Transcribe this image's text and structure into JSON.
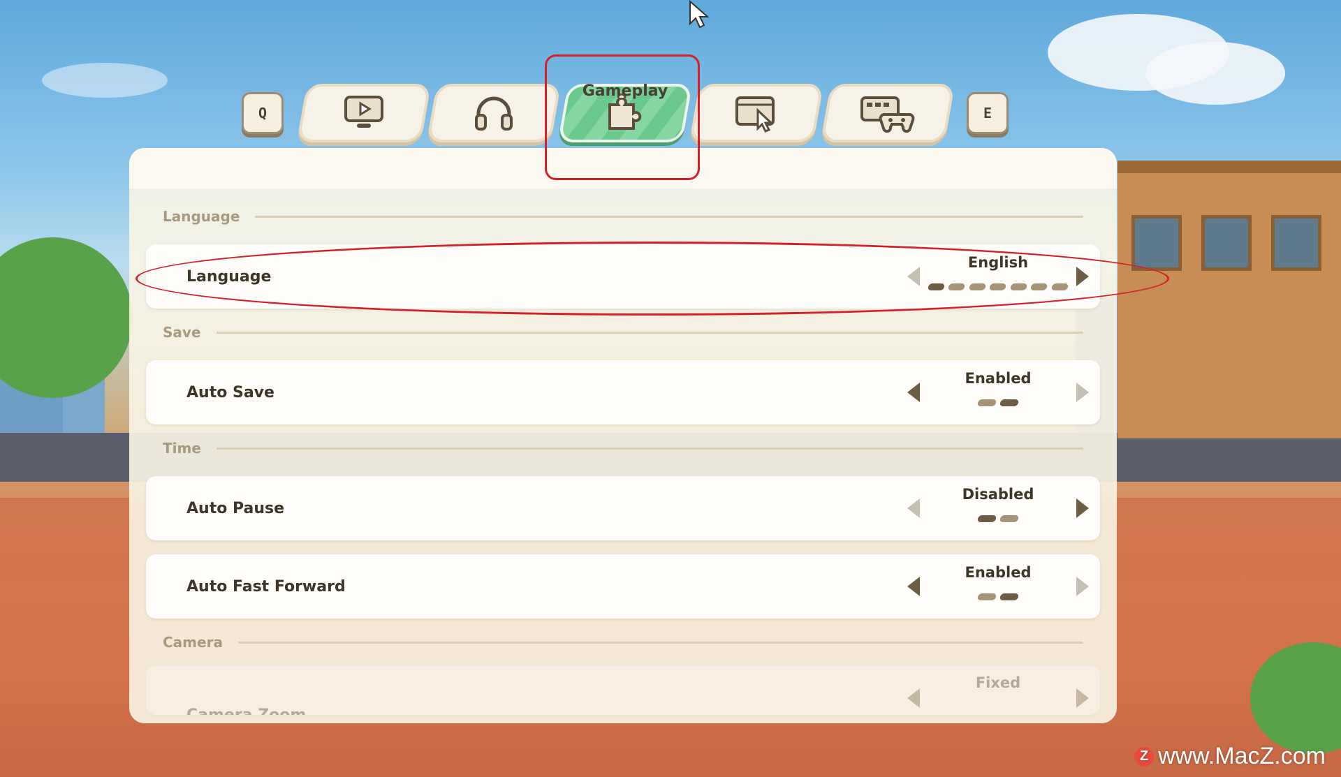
{
  "tabs": {
    "prev_key": "Q",
    "next_key": "E",
    "items": [
      {
        "icon": "monitor-play-icon",
        "label": "Display"
      },
      {
        "icon": "headphones-icon",
        "label": "Audio"
      },
      {
        "icon": "puzzle-icon",
        "label": "Gameplay",
        "active": true
      },
      {
        "icon": "window-cursor-icon",
        "label": "Interface"
      },
      {
        "icon": "keyboard-gamepad-icon",
        "label": "Controls"
      }
    ],
    "active_label": "Gameplay"
  },
  "sections": [
    {
      "title": "Language",
      "rows": [
        {
          "label": "Language",
          "value": "English",
          "options_count": 7,
          "selected_index": 0,
          "left_enabled": false,
          "right_enabled": true
        }
      ]
    },
    {
      "title": "Save",
      "rows": [
        {
          "label": "Auto Save",
          "value": "Enabled",
          "options_count": 2,
          "selected_index": 1,
          "left_enabled": true,
          "right_enabled": false
        }
      ]
    },
    {
      "title": "Time",
      "rows": [
        {
          "label": "Auto Pause",
          "value": "Disabled",
          "options_count": 2,
          "selected_index": 0,
          "left_enabled": false,
          "right_enabled": true
        },
        {
          "label": "Auto Fast Forward",
          "value": "Enabled",
          "options_count": 2,
          "selected_index": 1,
          "left_enabled": true,
          "right_enabled": false
        }
      ]
    },
    {
      "title": "Camera",
      "rows": [
        {
          "label": "Camera Zoom",
          "value": "Fixed"
        }
      ]
    }
  ],
  "watermark": {
    "logo": "Z",
    "text": "www.MacZ.com"
  },
  "colors": {
    "accent_green": "#6cc98e",
    "highlight_red": "#d5202a",
    "text_dark": "#3f3628",
    "section_text": "#a8997f"
  }
}
